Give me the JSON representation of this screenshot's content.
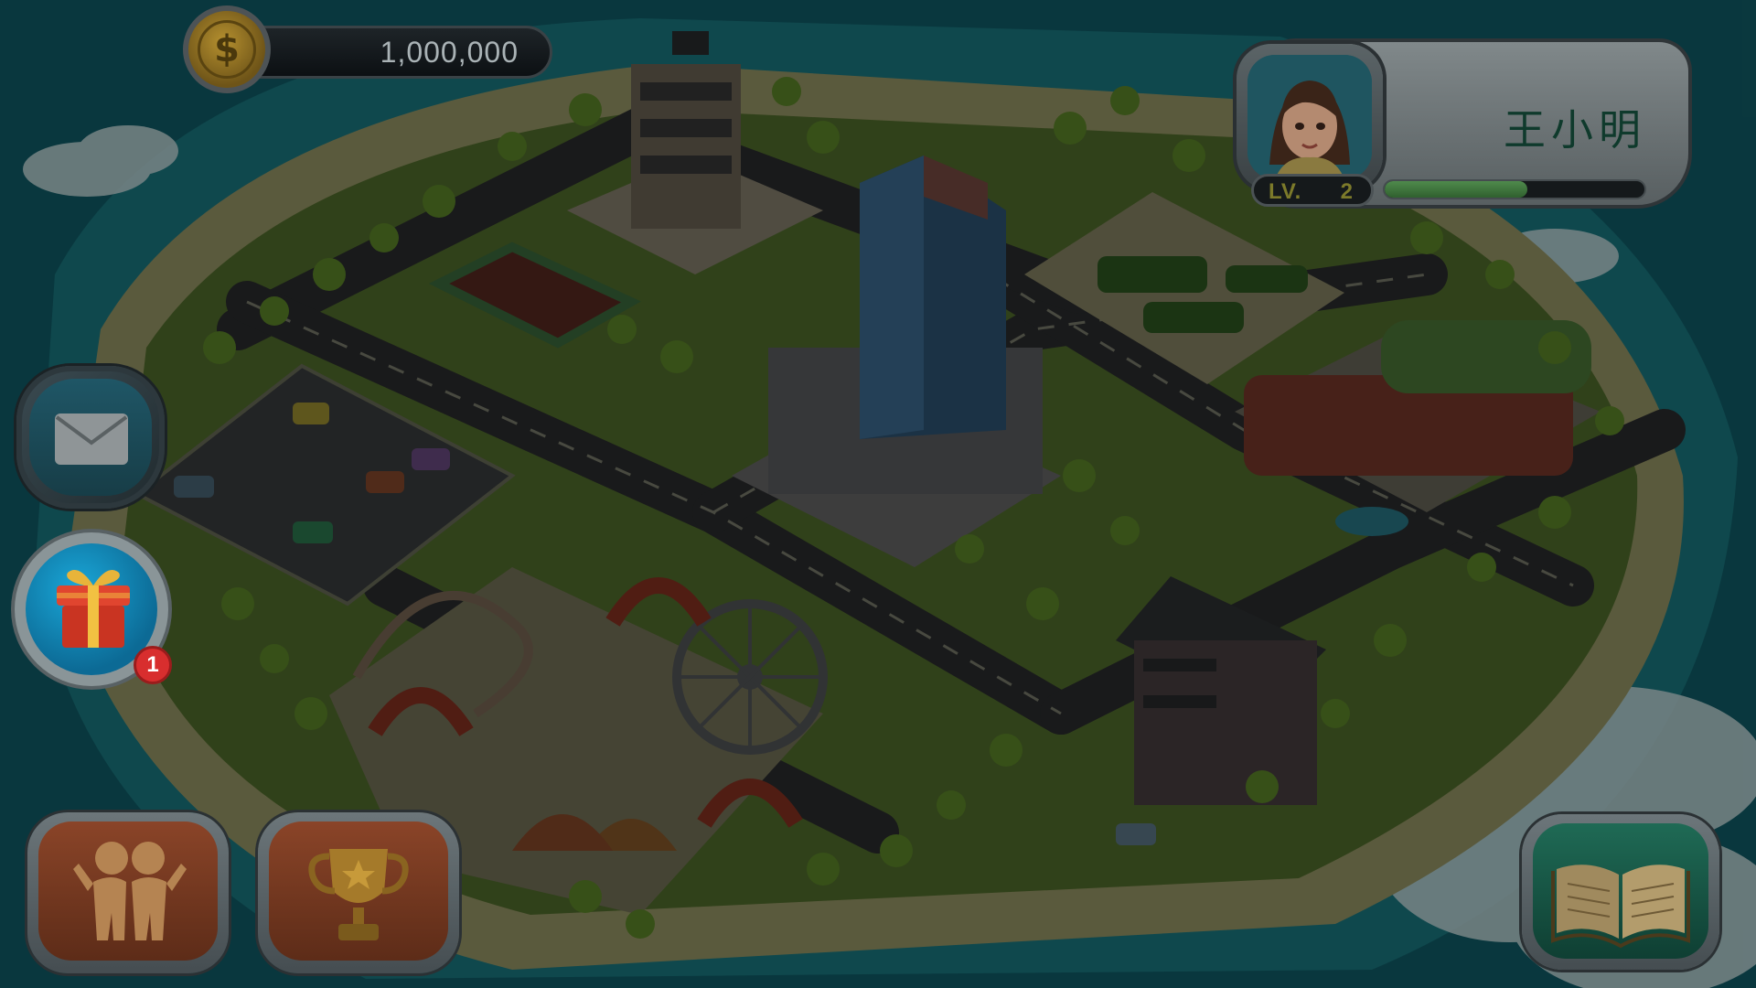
{
  "hud": {
    "coins": "1,000,000",
    "coin_symbol": "$"
  },
  "player": {
    "name": "王小明",
    "level_label": "LV.",
    "level": "2",
    "xp_progress": 0.55
  },
  "buttons": {
    "mail": {
      "icon": "envelope-icon"
    },
    "gift": {
      "icon": "gift-box-icon",
      "badge_count": "1"
    },
    "friends": {
      "icon": "friends-icon"
    },
    "achievements": {
      "icon": "trophy-icon"
    },
    "guide": {
      "icon": "open-book-icon"
    }
  },
  "colors": {
    "ocean": "#0e5560",
    "sand": "#8a8a5e",
    "grass": "#4f6a2c",
    "road": "#2d2f31",
    "accent_orange": "#8a4428",
    "accent_green": "#1f6a55",
    "badge_red": "#d82e2e"
  }
}
